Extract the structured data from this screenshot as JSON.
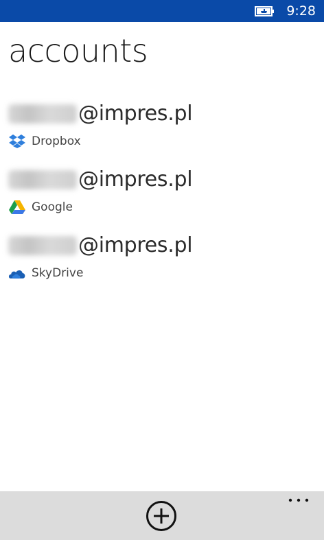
{
  "status_bar": {
    "time": "9:28",
    "battery_icon": "battery-charging-icon",
    "background": "#0a4aa8"
  },
  "page": {
    "title": "accounts"
  },
  "accounts": [
    {
      "email_domain": "@impres.pl",
      "service": "Dropbox",
      "icon": "dropbox-icon"
    },
    {
      "email_domain": "@impres.pl",
      "service": "Google",
      "icon": "google-drive-icon"
    },
    {
      "email_domain": "@impres.pl",
      "service": "SkyDrive",
      "icon": "skydrive-icon"
    }
  ],
  "app_bar": {
    "add_icon": "add-circle-icon",
    "more_icon": "more-ellipsis-icon",
    "background": "#dcdcdc"
  }
}
